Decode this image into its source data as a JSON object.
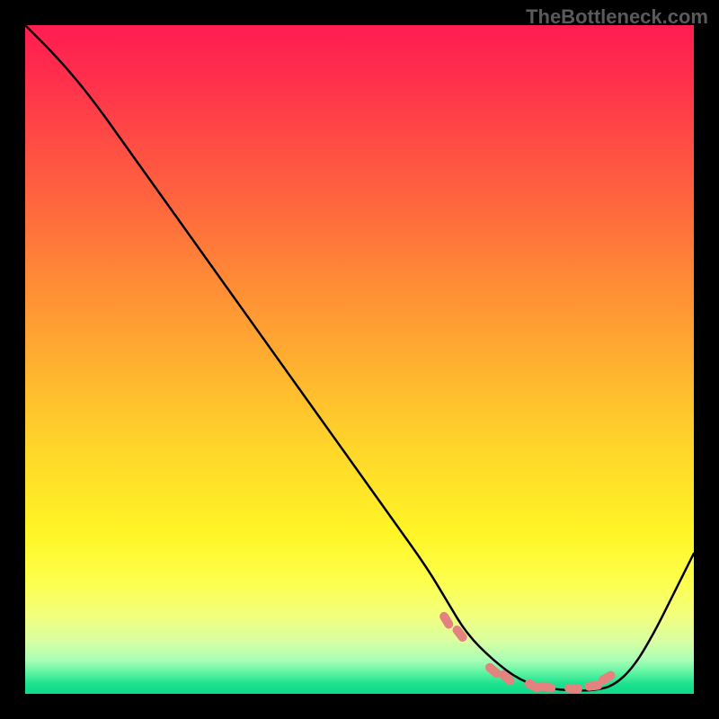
{
  "watermark": "TheBottleneck.com",
  "chart_data": {
    "type": "line",
    "title": "",
    "xlabel": "",
    "ylabel": "",
    "xlim": [
      0,
      100
    ],
    "ylim": [
      0,
      100
    ],
    "grid": false,
    "legend": false,
    "background_gradient": {
      "type": "vertical",
      "stops": [
        {
          "pos": 0,
          "color": "#ff1d52"
        },
        {
          "pos": 50,
          "color": "#ffc72c"
        },
        {
          "pos": 85,
          "color": "#fdff4b"
        },
        {
          "pos": 100,
          "color": "#0fd989"
        }
      ]
    },
    "series": [
      {
        "name": "main-curve",
        "color": "#000000",
        "x": [
          0,
          5,
          10,
          15,
          20,
          25,
          30,
          35,
          40,
          45,
          50,
          55,
          60,
          63,
          66,
          70,
          74,
          78,
          82,
          85,
          88,
          91,
          94,
          97,
          100
        ],
        "y": [
          100,
          95,
          89,
          82,
          75,
          68,
          61,
          54,
          47,
          40,
          33,
          26,
          19,
          14,
          9,
          5,
          2,
          0.8,
          0.5,
          0.5,
          1.2,
          4,
          9,
          15,
          21
        ],
        "note": "approximate trace of black bottleneck curve; y is percent of plot height from bottom"
      }
    ],
    "markers": {
      "name": "pink-dots",
      "color": "#e4827f",
      "x": [
        63,
        65,
        70,
        72,
        76,
        78,
        82,
        85,
        87
      ],
      "y": [
        11,
        9,
        3.5,
        2.4,
        1.2,
        1,
        0.8,
        1.2,
        2.4
      ],
      "note": "approximate positions of salmon/pink dashed markers near curve minimum"
    }
  }
}
